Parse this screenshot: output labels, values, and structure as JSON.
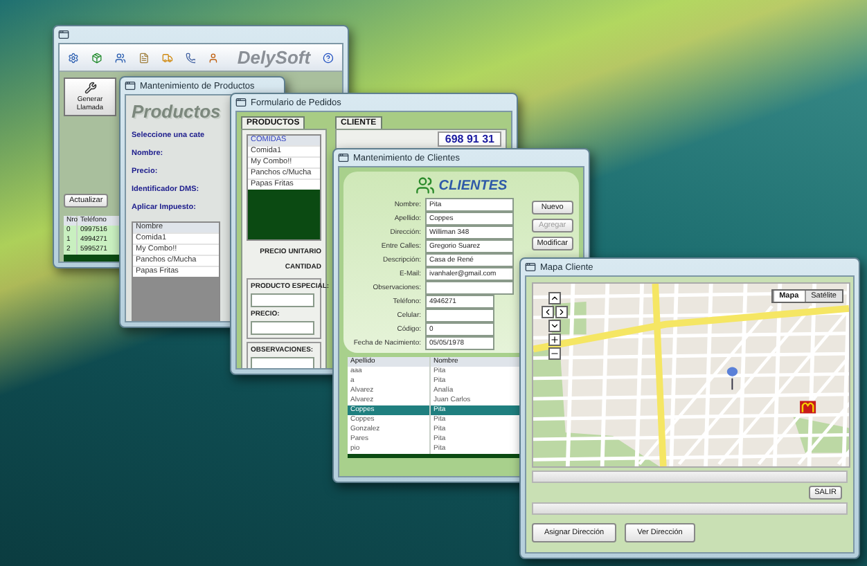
{
  "main_window": {
    "logo": "DelySoft",
    "call_button": "Generar Llamada",
    "refresh_button": "Actualizar",
    "table": {
      "columns": [
        "Nro",
        "Teléfono"
      ],
      "rows": [
        {
          "cells": [
            "0",
            "0997516"
          ],
          "selected": false
        },
        {
          "cells": [
            "1",
            "4994271"
          ],
          "selected": false
        },
        {
          "cells": [
            "2",
            "5995271"
          ],
          "selected": false
        }
      ]
    }
  },
  "products_window": {
    "title": "Mantenimiento de Productos",
    "heading": "Productos",
    "labels": [
      "Seleccione una cate",
      "Nombre:",
      "Precio:",
      "Identificador DMS:",
      "Aplicar Impuesto:"
    ],
    "list": {
      "header": "Nombre",
      "items": [
        "Comida1",
        "My Combo!!",
        "Panchos c/Mucha",
        "Papas Fritas"
      ]
    }
  },
  "orders_window": {
    "title": "Formulario de Pedidos",
    "products_tab": "PRODUCTOS",
    "category_list": {
      "header": "COMIDAS",
      "items": [
        "Comida1",
        "My Combo!!",
        "Panchos c/Mucha",
        "Papas Fritas"
      ]
    },
    "client_tab": "CLIENTE",
    "phone": "698 91 31",
    "unit_price_label": "PRECIO UNITARIO",
    "quantity_label": "CANTIDAD",
    "special_label": "PRODUCTO ESPECIAL:",
    "price_label": "PRECIO:",
    "notes_label": "OBSERVACIONES:"
  },
  "clients_window": {
    "title": "Mantenimiento de Clientes",
    "heading": "CLIENTES",
    "fields": [
      {
        "label": "Nombre:",
        "value": "Pita"
      },
      {
        "label": "Apellido:",
        "value": "Coppes"
      },
      {
        "label": "Dirección:",
        "value": "Williman 348"
      },
      {
        "label": "Entre Calles:",
        "value": "Gregorio Suarez"
      },
      {
        "label": "Descripción:",
        "value": "Casa de René"
      },
      {
        "label": "E-Mail:",
        "value": "ivanhaler@gmail.com"
      },
      {
        "label": "Observaciones:"
      },
      {
        "label": "Teléfono:",
        "value": "4946271"
      },
      {
        "label": "Celular:"
      },
      {
        "label": "Código:",
        "value": "0"
      },
      {
        "label": "Fecha de Nacimiento:",
        "value": "05/05/1978"
      }
    ],
    "buttons": [
      {
        "label": "Nuevo",
        "disabled": false
      },
      {
        "label": "Agregar",
        "disabled": true
      },
      {
        "label": "Modificar",
        "disabled": false
      }
    ],
    "table": {
      "columns": [
        "Apellido",
        "Nombre"
      ],
      "rows": [
        {
          "cells": [
            "aaa",
            "Pita"
          ],
          "selected": false
        },
        {
          "cells": [
            "a",
            "Pita"
          ],
          "selected": false
        },
        {
          "cells": [
            "Alvarez",
            "Analía"
          ],
          "selected": false
        },
        {
          "cells": [
            "Alvarez",
            "Juan Carlos"
          ],
          "selected": false
        },
        {
          "cells": [
            "Coppes",
            "Pita"
          ],
          "selected": true
        },
        {
          "cells": [
            "Coppes",
            "Pita"
          ],
          "selected": false
        },
        {
          "cells": [
            "Gonzalez",
            "Pita"
          ],
          "selected": false
        },
        {
          "cells": [
            "Pares",
            "Pita"
          ],
          "selected": false
        },
        {
          "cells": [
            "pio",
            "Pita"
          ],
          "selected": false
        }
      ]
    }
  },
  "map_window": {
    "title": "Mapa Cliente",
    "map_types": [
      {
        "label": "Mapa",
        "selected": true
      },
      {
        "label": "Satélite",
        "selected": false
      }
    ],
    "exit_button": "SALIR",
    "buttons": [
      "Asignar Dirección",
      "Ver Dirección"
    ]
  }
}
